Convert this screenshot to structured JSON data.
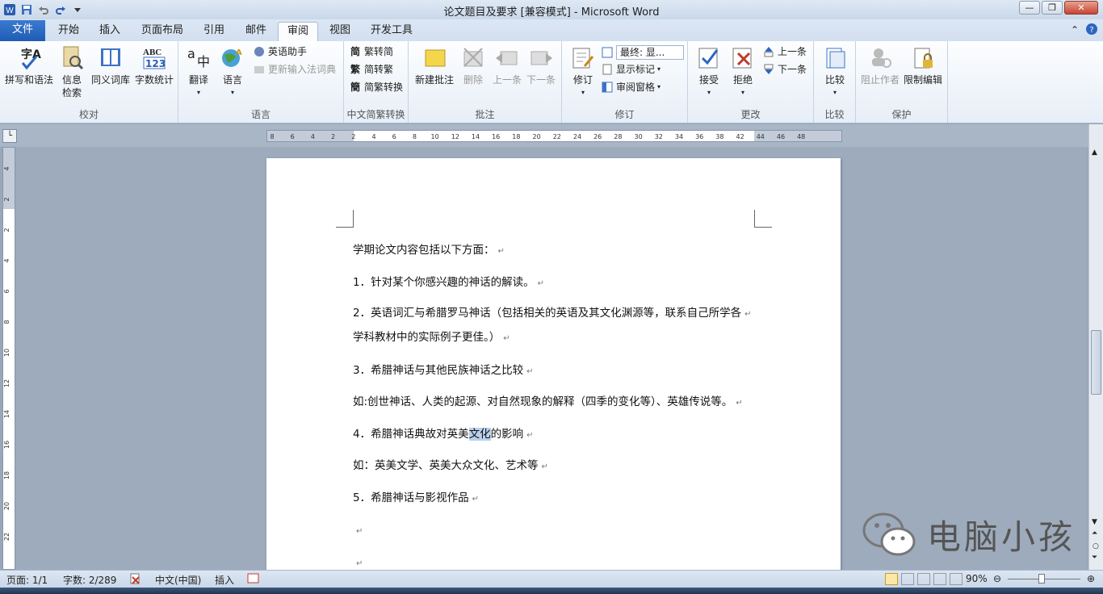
{
  "window": {
    "title": "论文题目及要求 [兼容模式] - Microsoft Word"
  },
  "tabs": [
    {
      "label": "文件"
    },
    {
      "label": "开始"
    },
    {
      "label": "插入"
    },
    {
      "label": "页面布局"
    },
    {
      "label": "引用"
    },
    {
      "label": "邮件"
    },
    {
      "label": "审阅"
    },
    {
      "label": "视图"
    },
    {
      "label": "开发工具"
    }
  ],
  "ribbon": {
    "proofing": {
      "label": "校对",
      "spelling": "拼写和语法",
      "research_1": "信息",
      "research_2": "检索",
      "thesaurus": "同义词库",
      "wordcount": "字数统计"
    },
    "language": {
      "label": "语言",
      "translate": "翻译",
      "language": "语言",
      "english_assist": "英语助手",
      "update_ime": "更新输入法词典"
    },
    "chinese": {
      "label": "中文简繁转换",
      "t2s": "繁转简",
      "s2t": "简转繁",
      "convert": "简繁转换"
    },
    "comments": {
      "label": "批注",
      "new": "新建批注",
      "delete": "删除",
      "prev": "上一条",
      "next": "下一条"
    },
    "tracking": {
      "label": "修订",
      "track": "修订",
      "display_mode": "最终: 显...",
      "show_markup": "显示标记",
      "pane": "审阅窗格"
    },
    "changes": {
      "label": "更改",
      "accept": "接受",
      "reject": "拒绝",
      "prev": "上一条",
      "next": "下一条"
    },
    "compare": {
      "label": "比较",
      "compare": "比较"
    },
    "protect": {
      "label": "保护",
      "block": "阻止作者",
      "restrict": "限制编辑"
    }
  },
  "ruler": {
    "h_ticks": [
      "8",
      "6",
      "4",
      "2",
      "2",
      "4",
      "6",
      "8",
      "10",
      "12",
      "14",
      "16",
      "18",
      "20",
      "22",
      "24",
      "26",
      "28",
      "30",
      "32",
      "34",
      "36",
      "38",
      "42",
      "44",
      "46",
      "48"
    ],
    "v_ticks": [
      "4",
      "2",
      "2",
      "4",
      "6",
      "8",
      "10",
      "12",
      "14",
      "16",
      "18",
      "20",
      "22"
    ]
  },
  "document": {
    "paragraphs": [
      {
        "text": "学期论文内容包括以下方面：",
        "pre": "",
        "sel": "",
        "post": ""
      },
      {
        "text": "1．针对某个你感兴趣的神话的解读。",
        "pre": "",
        "sel": "",
        "post": ""
      },
      {
        "text": "2．英语词汇与希腊罗马神话（包括相关的英语及其文化渊源等，联系自己所学各",
        "pre": "",
        "sel": "",
        "post": ""
      },
      {
        "text": "学科教材中的实际例子更佳。）",
        "pre": "",
        "sel": "",
        "post": ""
      },
      {
        "text": "3．希腊神话与其他民族神话之比较",
        "pre": "",
        "sel": "",
        "post": ""
      },
      {
        "text": "如:创世神话、人类的起源、对自然现象的解释（四季的变化等）、英雄传说等。",
        "pre": "",
        "sel": "",
        "post": ""
      },
      {
        "text": "",
        "pre": "4．希腊神话典故对英美",
        "sel": "文化",
        "post": "的影响"
      },
      {
        "text": "如：英美文学、英美大众文化、艺术等",
        "pre": "",
        "sel": "",
        "post": ""
      },
      {
        "text": "5．希腊神话与影视作品",
        "pre": "",
        "sel": "",
        "post": ""
      },
      {
        "text": "",
        "pre": "",
        "sel": "",
        "post": ""
      },
      {
        "text": "",
        "pre": "",
        "sel": "",
        "post": ""
      }
    ],
    "para_mark": "↵"
  },
  "status": {
    "page": "页面: 1/1",
    "words": "字数: 2/289",
    "lang": "中文(中国)",
    "insert": "插入",
    "zoom": "90%"
  },
  "watermark": {
    "text": "电脑小孩"
  },
  "colors": {
    "file_tab": "#2a66c0",
    "selection": "#b8d0ed"
  }
}
